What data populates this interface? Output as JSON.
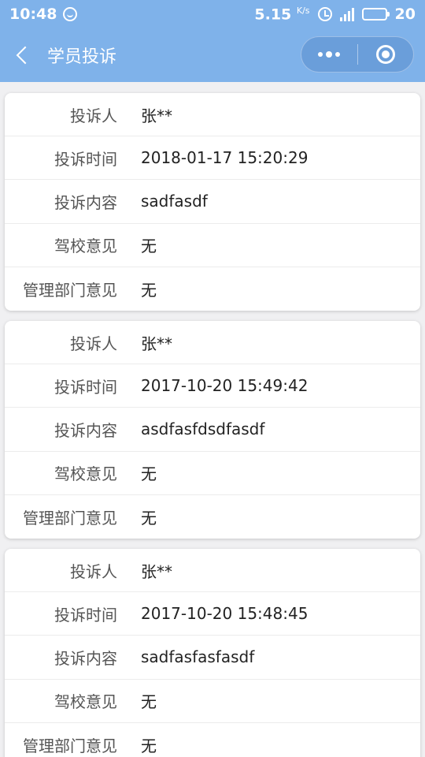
{
  "status_bar": {
    "time": "10:48",
    "speed": "5.15",
    "speed_unit": "K/s",
    "network": "4G",
    "battery": "20"
  },
  "nav": {
    "title": "学员投诉"
  },
  "labels": {
    "complainant": "投诉人",
    "time": "投诉时间",
    "content": "投诉内容",
    "school_opinion": "驾校意见",
    "dept_opinion": "管理部门意见"
  },
  "complaints": [
    {
      "complainant": "张**",
      "time": "2018-01-17 15:20:29",
      "content": "sadfasdf",
      "school_opinion": "无",
      "dept_opinion": "无"
    },
    {
      "complainant": "张**",
      "time": "2017-10-20 15:49:42",
      "content": "asdfasfdsdfasdf",
      "school_opinion": "无",
      "dept_opinion": "无"
    },
    {
      "complainant": "张**",
      "time": "2017-10-20 15:48:45",
      "content": "sadfasfasfasdf",
      "school_opinion": "无",
      "dept_opinion": "无"
    }
  ]
}
